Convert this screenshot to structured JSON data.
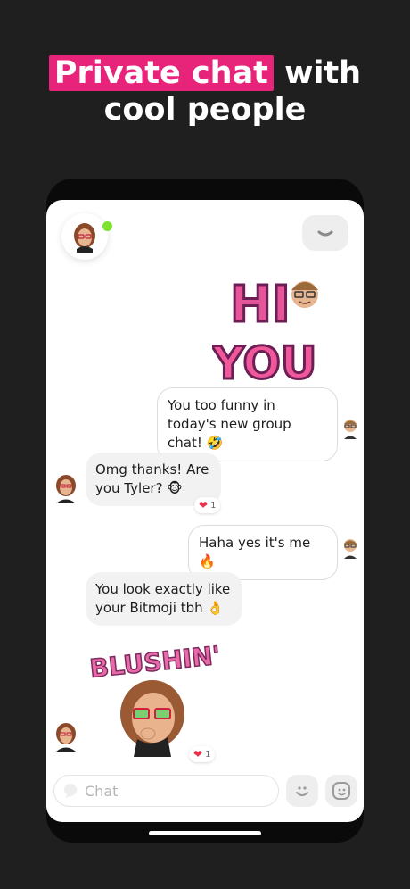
{
  "headline": {
    "highlight": "Private chat",
    "rest_line1": " with",
    "line2": "cool people"
  },
  "messages": {
    "m1": "You too funny in today's new group chat! 🤣",
    "m2": "Omg thanks! Are you Tyler? 🐵",
    "m2_reaction_count": "1",
    "m3": "Haha yes it's me 🔥",
    "m4": "You look exactly like your Bitmoji tbh 👌",
    "sticker2_reaction_count": "1"
  },
  "stickers": {
    "s1_line1": "HI",
    "s1_line2": "YOU",
    "s2_text": "BLUSHIN'"
  },
  "composer": {
    "placeholder": "Chat"
  },
  "colors": {
    "accent": "#e7247a",
    "online": "#7ee22e",
    "heart": "#e8314f"
  }
}
